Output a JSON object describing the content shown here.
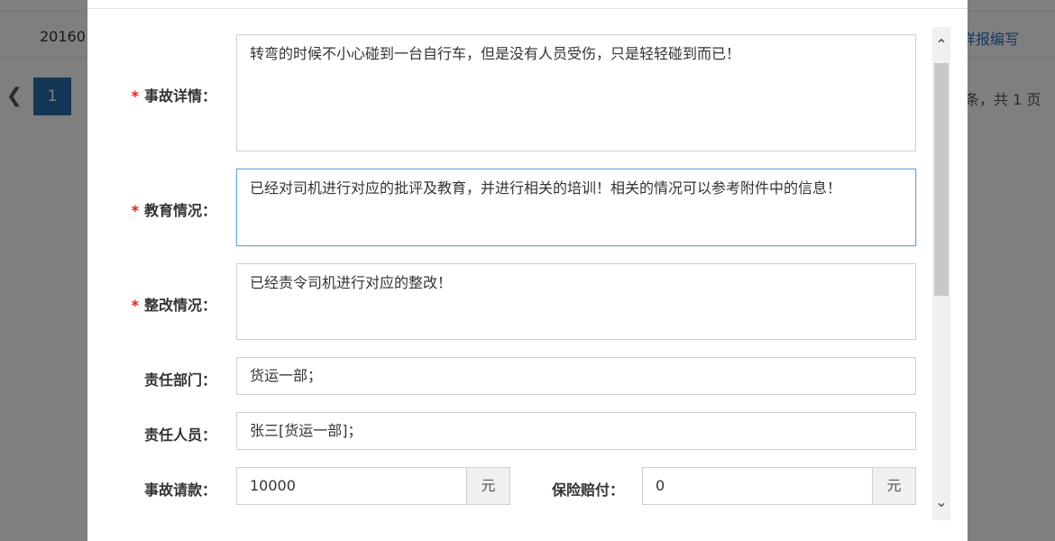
{
  "background": {
    "row_text": "20160",
    "row_link": "详报编写",
    "pager": {
      "prev_icon": "chevron-left-icon",
      "current_page": "1",
      "info": "条，共 1 页"
    }
  },
  "form": {
    "accident_details": {
      "label": "事故详情：",
      "required_mark": "*",
      "value": "转弯的时候不小心碰到一台自行车，但是没有人员受伤，只是轻轻碰到而已！"
    },
    "education": {
      "label": "教育情况：",
      "required_mark": "*",
      "value": "已经对司机进行对应的批评及教育，并进行相关的培训！相关的情况可以参考附件中的信息！"
    },
    "rectification": {
      "label": "整改情况：",
      "required_mark": "*",
      "value": "已经责令司机进行对应的整改！"
    },
    "responsible_dept": {
      "label": "责任部门：",
      "value": "货运一部；"
    },
    "responsible_person": {
      "label": "责任人员：",
      "value": "张三[货运一部]；"
    },
    "accident_claim": {
      "label": "事故请款：",
      "value": "10000",
      "unit": "元"
    },
    "insurance_payment": {
      "label": "保险赔付：",
      "value": "0",
      "unit": "元"
    }
  },
  "scrollbar": {
    "up_icon": "chevron-up-icon",
    "down_icon": "chevron-down-icon"
  }
}
